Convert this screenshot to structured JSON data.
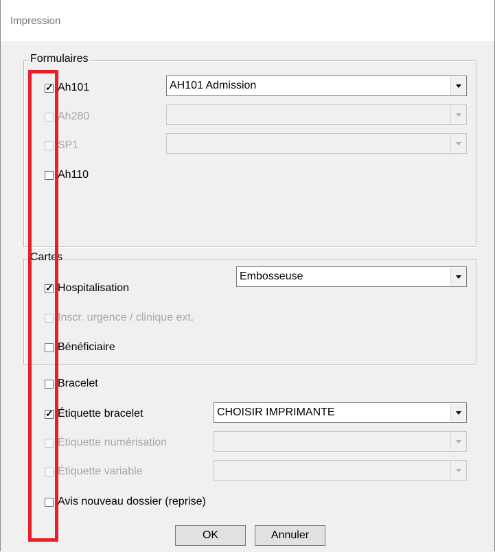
{
  "window": {
    "title": "Impression"
  },
  "formulaires": {
    "legend": "Formulaires",
    "items": [
      {
        "label": "Ah101",
        "checked": true,
        "enabled": true,
        "combo": {
          "value": "AH101 Admission",
          "enabled": true
        }
      },
      {
        "label": "Ah280",
        "checked": false,
        "enabled": false,
        "combo": {
          "value": "",
          "enabled": false
        }
      },
      {
        "label": "SP1",
        "checked": false,
        "enabled": false,
        "combo": {
          "value": "",
          "enabled": false
        }
      },
      {
        "label": "Ah110",
        "checked": false,
        "enabled": true
      }
    ]
  },
  "cartes": {
    "legend": "Cartes",
    "combo": {
      "value": "Embosseuse",
      "enabled": true
    },
    "items": [
      {
        "label": "Hospitalisation",
        "checked": true,
        "enabled": true
      },
      {
        "label": "Inscr. urgence / clinique ext.",
        "checked": false,
        "enabled": false
      },
      {
        "label": "Bénéficiaire",
        "checked": false,
        "enabled": true
      }
    ]
  },
  "other": {
    "items": [
      {
        "label": "Bracelet",
        "checked": false,
        "enabled": true
      },
      {
        "label": "Étiquette bracelet",
        "checked": true,
        "enabled": true,
        "combo": {
          "value": "CHOISIR IMPRIMANTE",
          "enabled": true
        }
      },
      {
        "label": "Étiquette numérisation",
        "checked": false,
        "enabled": false,
        "combo": {
          "value": "",
          "enabled": false
        }
      },
      {
        "label": "Étiquette variable",
        "checked": false,
        "enabled": false,
        "combo": {
          "value": "",
          "enabled": false
        }
      },
      {
        "label": "Avis nouveau dossier (reprise)",
        "checked": false,
        "enabled": true
      }
    ]
  },
  "buttons": {
    "ok": "OK",
    "cancel": "Annuler"
  },
  "colors": {
    "highlight": "#e5202a",
    "disabled_text": "#a8a8a8"
  }
}
